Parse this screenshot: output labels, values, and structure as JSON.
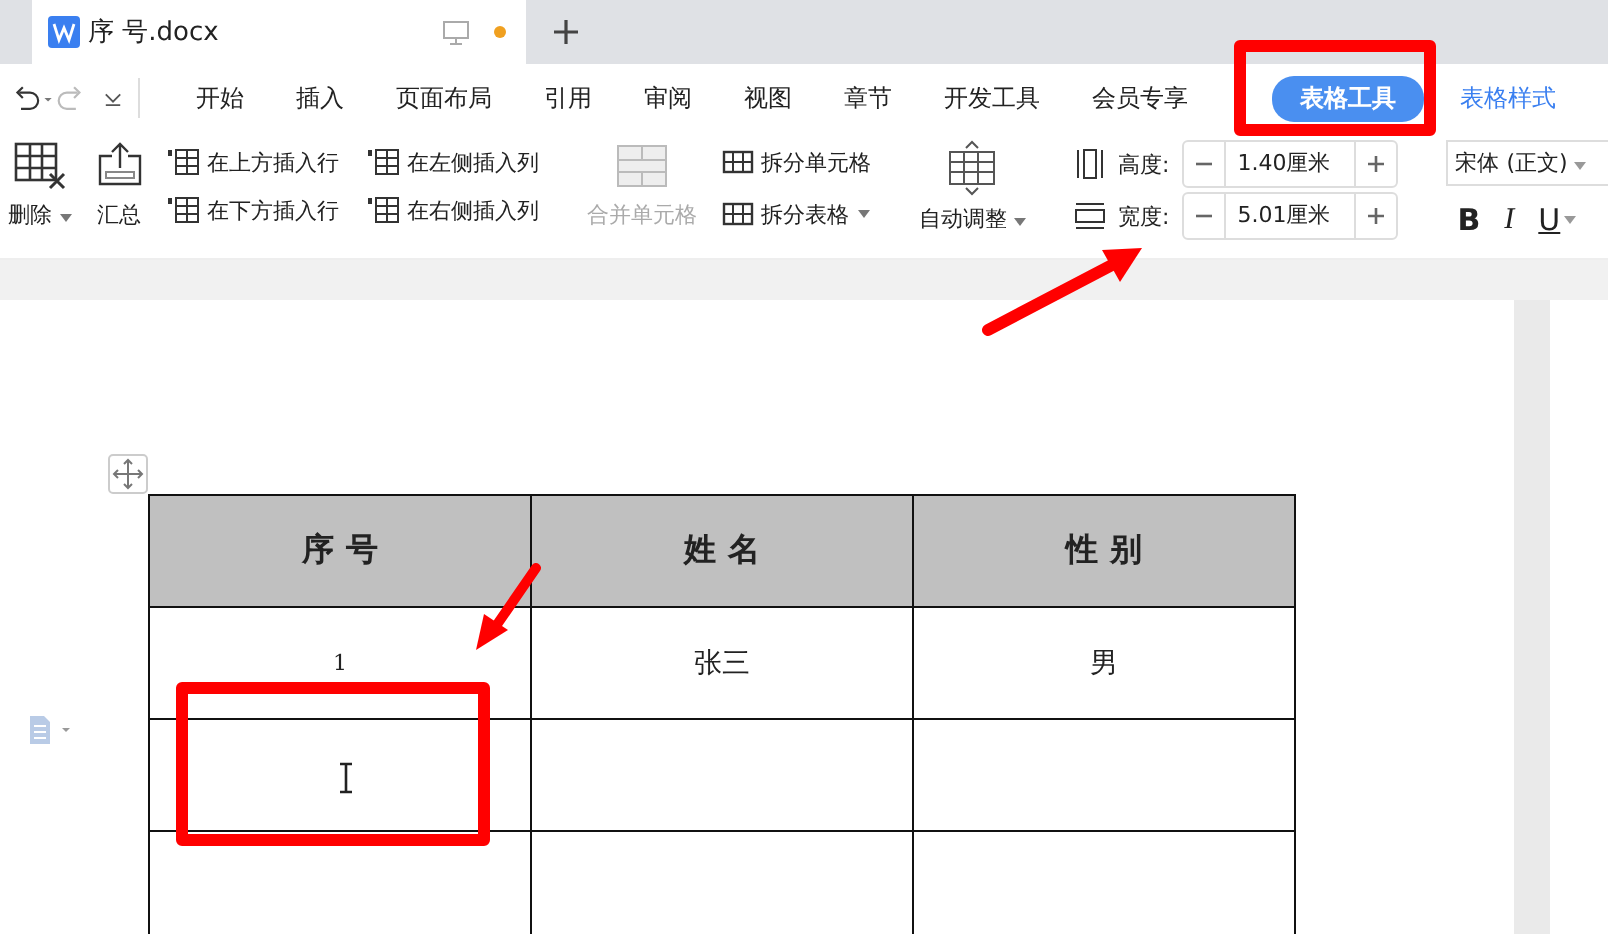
{
  "document_tab": {
    "title": "序 号.docx",
    "unsaved": true
  },
  "menu": [
    {
      "label": "开始",
      "selected": false
    },
    {
      "label": "插入",
      "selected": false
    },
    {
      "label": "页面布局",
      "selected": false
    },
    {
      "label": "引用",
      "selected": false
    },
    {
      "label": "审阅",
      "selected": false
    },
    {
      "label": "视图",
      "selected": false
    },
    {
      "label": "章节",
      "selected": false
    },
    {
      "label": "开发工具",
      "selected": false
    },
    {
      "label": "会员专享",
      "selected": false
    },
    {
      "label": "表格工具",
      "selected": true
    },
    {
      "label": "表格样式",
      "selected": false
    }
  ],
  "ribbon": {
    "delete_label": "删除",
    "summary_label": "汇总",
    "insert_buttons": [
      "在上方插入行",
      "在下方插入行",
      "在左侧插入列",
      "在右侧插入列"
    ],
    "merge": {
      "label": "合并单元格",
      "disabled": true
    },
    "split_buttons": [
      "拆分单元格",
      "拆分表格"
    ],
    "auto_fit": "自动调整",
    "height": {
      "label": "高度:",
      "value": "1.40厘米"
    },
    "width": {
      "label": "宽度:",
      "value": "5.01厘米"
    },
    "font": "宋体 (正文)",
    "format_buttons": [
      "B",
      "I",
      "U"
    ]
  },
  "table": {
    "columns": [
      "序 号",
      "姓 名",
      "性 别"
    ],
    "rows": [
      [
        "1",
        "张三",
        "男"
      ],
      [
        null,
        null,
        null
      ],
      [
        null,
        null,
        null
      ]
    ]
  }
}
